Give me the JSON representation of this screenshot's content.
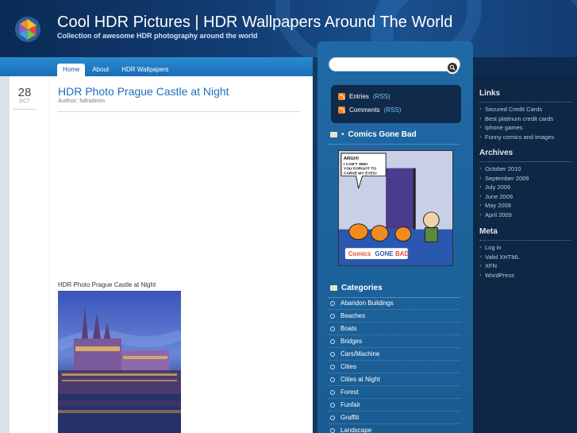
{
  "site": {
    "title": "Cool HDR Pictures | HDR Wallpapers Around The World",
    "tagline": "Collection of awesome HDR photography around the world"
  },
  "nav": {
    "tabs": [
      "Home",
      "About",
      "HDR Wallpapers"
    ],
    "active": "Home"
  },
  "post": {
    "day": "28",
    "month": "OCT",
    "title": "HDR Photo Prague Castle at Night",
    "author": "Author: hdradmin",
    "caption": "HDR Photo Prague Castle at Night"
  },
  "search": {
    "placeholder": ""
  },
  "rss": {
    "entries_label": "Entries",
    "comments_label": "Comments",
    "rss_link": "(RSS)"
  },
  "widgets": {
    "comics_title": "Comics Gone Bad",
    "comic": {
      "caption_text": "ARGH! I CAN'T SEE! YOU FORGOT TO CARVE MY EYES!",
      "brand": "Comics GONE BAD"
    },
    "categories_title": "Categories",
    "categories": [
      "Abandon Buildings",
      "Beaches",
      "Boats",
      "Bridges",
      "Cars/Machine",
      "Cities",
      "Cities at Night",
      "Forest",
      "Funfair",
      "Graffiti",
      "Landscape"
    ]
  },
  "right_sidebar": {
    "links_title": "Links",
    "links": [
      "Secured Credit Cards",
      "Best platinum credit cards",
      "Iphone games",
      "Funny comics and images"
    ],
    "archives_title": "Archives",
    "archives": [
      "October 2010",
      "September 2009",
      "July 2009",
      "June 2009",
      "May 2009",
      "April 2009"
    ],
    "meta_title": "Meta",
    "meta": [
      "Log in",
      "Valid XHTML",
      "XFN",
      "WordPress"
    ]
  },
  "colors": {
    "header_bg": "#123d73",
    "link_blue": "#1d6fbd",
    "sidebar_blue": "#1f6aa6",
    "rss_orange": "#f08a24",
    "right_bg": "#0e2745"
  }
}
